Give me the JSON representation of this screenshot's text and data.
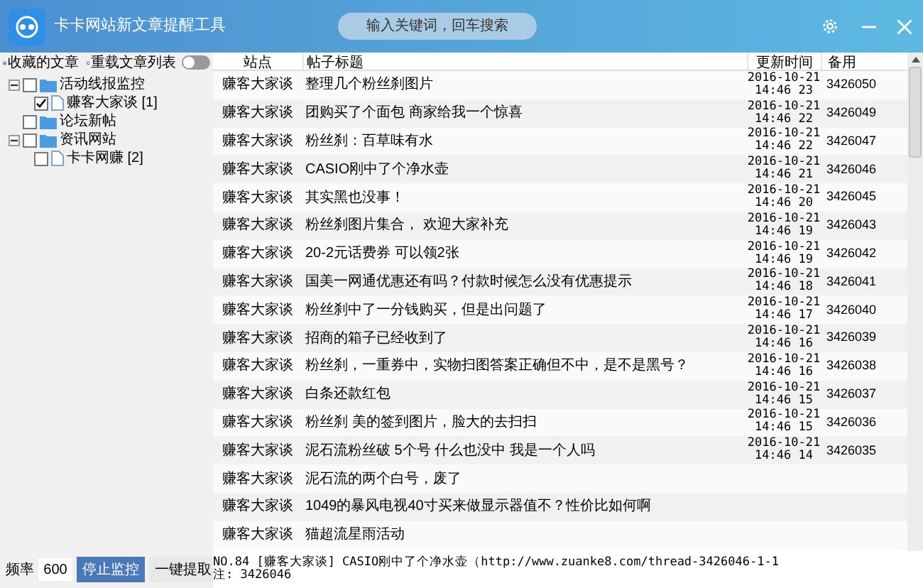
{
  "window": {
    "title": "卡卡网站新文章提醒工具"
  },
  "search": {
    "placeholder": "输入关键词，回车搜索"
  },
  "sidebar": {
    "favorites": "收藏的文章",
    "reload": "重载文章列表",
    "toggle": {
      "on": false
    },
    "tree": [
      {
        "label": "活动线报监控",
        "checked": false,
        "expanded": true,
        "children": [
          {
            "label": "赚客大家谈",
            "count": "[1]",
            "checked": true
          }
        ]
      },
      {
        "label": "论坛新帖",
        "checked": false
      },
      {
        "label": "资讯网站",
        "checked": false,
        "expanded": true,
        "children": [
          {
            "label": "卡卡网赚",
            "count": "[2]",
            "checked": false
          }
        ]
      }
    ]
  },
  "table": {
    "columns": [
      "站点",
      "帖子标题",
      "更新时间",
      "备用"
    ],
    "rows": [
      {
        "site": "赚客大家谈",
        "title": "整理几个粉丝刹图片",
        "date": "2016-10-21",
        "time": "14:46 23",
        "id": "3426050"
      },
      {
        "site": "赚客大家谈",
        "title": "团购买了个面包  商家给我一个惊喜",
        "date": "2016-10-21",
        "time": "14:46 22",
        "id": "3426049"
      },
      {
        "site": "赚客大家谈",
        "title": "粉丝刹：百草味有水",
        "date": "2016-10-21",
        "time": "14:46 22",
        "id": "3426047"
      },
      {
        "site": "赚客大家谈",
        "title": "CASIO刚中了个净水壶",
        "date": "2016-10-21",
        "time": "14:46 21",
        "id": "3426046"
      },
      {
        "site": "赚客大家谈",
        "title": "其实黑也没事！",
        "date": "2016-10-21",
        "time": "14:46 20",
        "id": "3426045"
      },
      {
        "site": "赚客大家谈",
        "title": "粉丝刹图片集合， 欢迎大家补充",
        "date": "2016-10-21",
        "time": "14:46 19",
        "id": "3426043"
      },
      {
        "site": "赚客大家谈",
        "title": "20-2元话费券 可以领2张",
        "date": "2016-10-21",
        "time": "14:46 19",
        "id": "3426042"
      },
      {
        "site": "赚客大家谈",
        "title": "国美一网通优惠还有吗？付款时候怎么没有优惠提示",
        "date": "2016-10-21",
        "time": "14:46 18",
        "id": "3426041"
      },
      {
        "site": "赚客大家谈",
        "title": "粉丝刹中了一分钱购买，但是出问题了",
        "date": "2016-10-21",
        "time": "14:46 17",
        "id": "3426040"
      },
      {
        "site": "赚客大家谈",
        "title": "招商的箱子已经收到了",
        "date": "2016-10-21",
        "time": "14:46 16",
        "id": "3426039"
      },
      {
        "site": "赚客大家谈",
        "title": "粉丝刹，一重券中，实物扫图答案正确但不中，是不是黑号？",
        "date": "2016-10-21",
        "time": "14:46 16",
        "id": "3426038"
      },
      {
        "site": "赚客大家谈",
        "title": "白条还款红包",
        "date": "2016-10-21",
        "time": "14:46 15",
        "id": "3426037"
      },
      {
        "site": "赚客大家谈",
        "title": "粉丝刹 美的签到图片，脸大的去扫扫",
        "date": "2016-10-21",
        "time": "14:46 15",
        "id": "3426036"
      },
      {
        "site": "赚客大家谈",
        "title": "泥石流粉丝破 5个号 什么也没中 我是一个人吗",
        "date": "2016-10-21",
        "time": "14:46 14",
        "id": "3426035"
      },
      {
        "site": "赚客大家谈",
        "title": "泥石流的两个白号，废了"
      },
      {
        "site": "赚客大家谈",
        "title": "1049的暴风电视40寸买来做显示器值不？性价比如何啊"
      },
      {
        "site": "赚客大家谈",
        "title": "猫超流星雨活动"
      }
    ]
  },
  "controls": {
    "frequency_label": "频率",
    "frequency": "600",
    "stop": "停止监控",
    "extract": "一键提取"
  },
  "detail": [
    "NO.84 [赚客大家谈] CASIO刚中了个净水壶（http://www.zuanke8.com/thread-3426046-1-1",
    "注: 3426046"
  ]
}
